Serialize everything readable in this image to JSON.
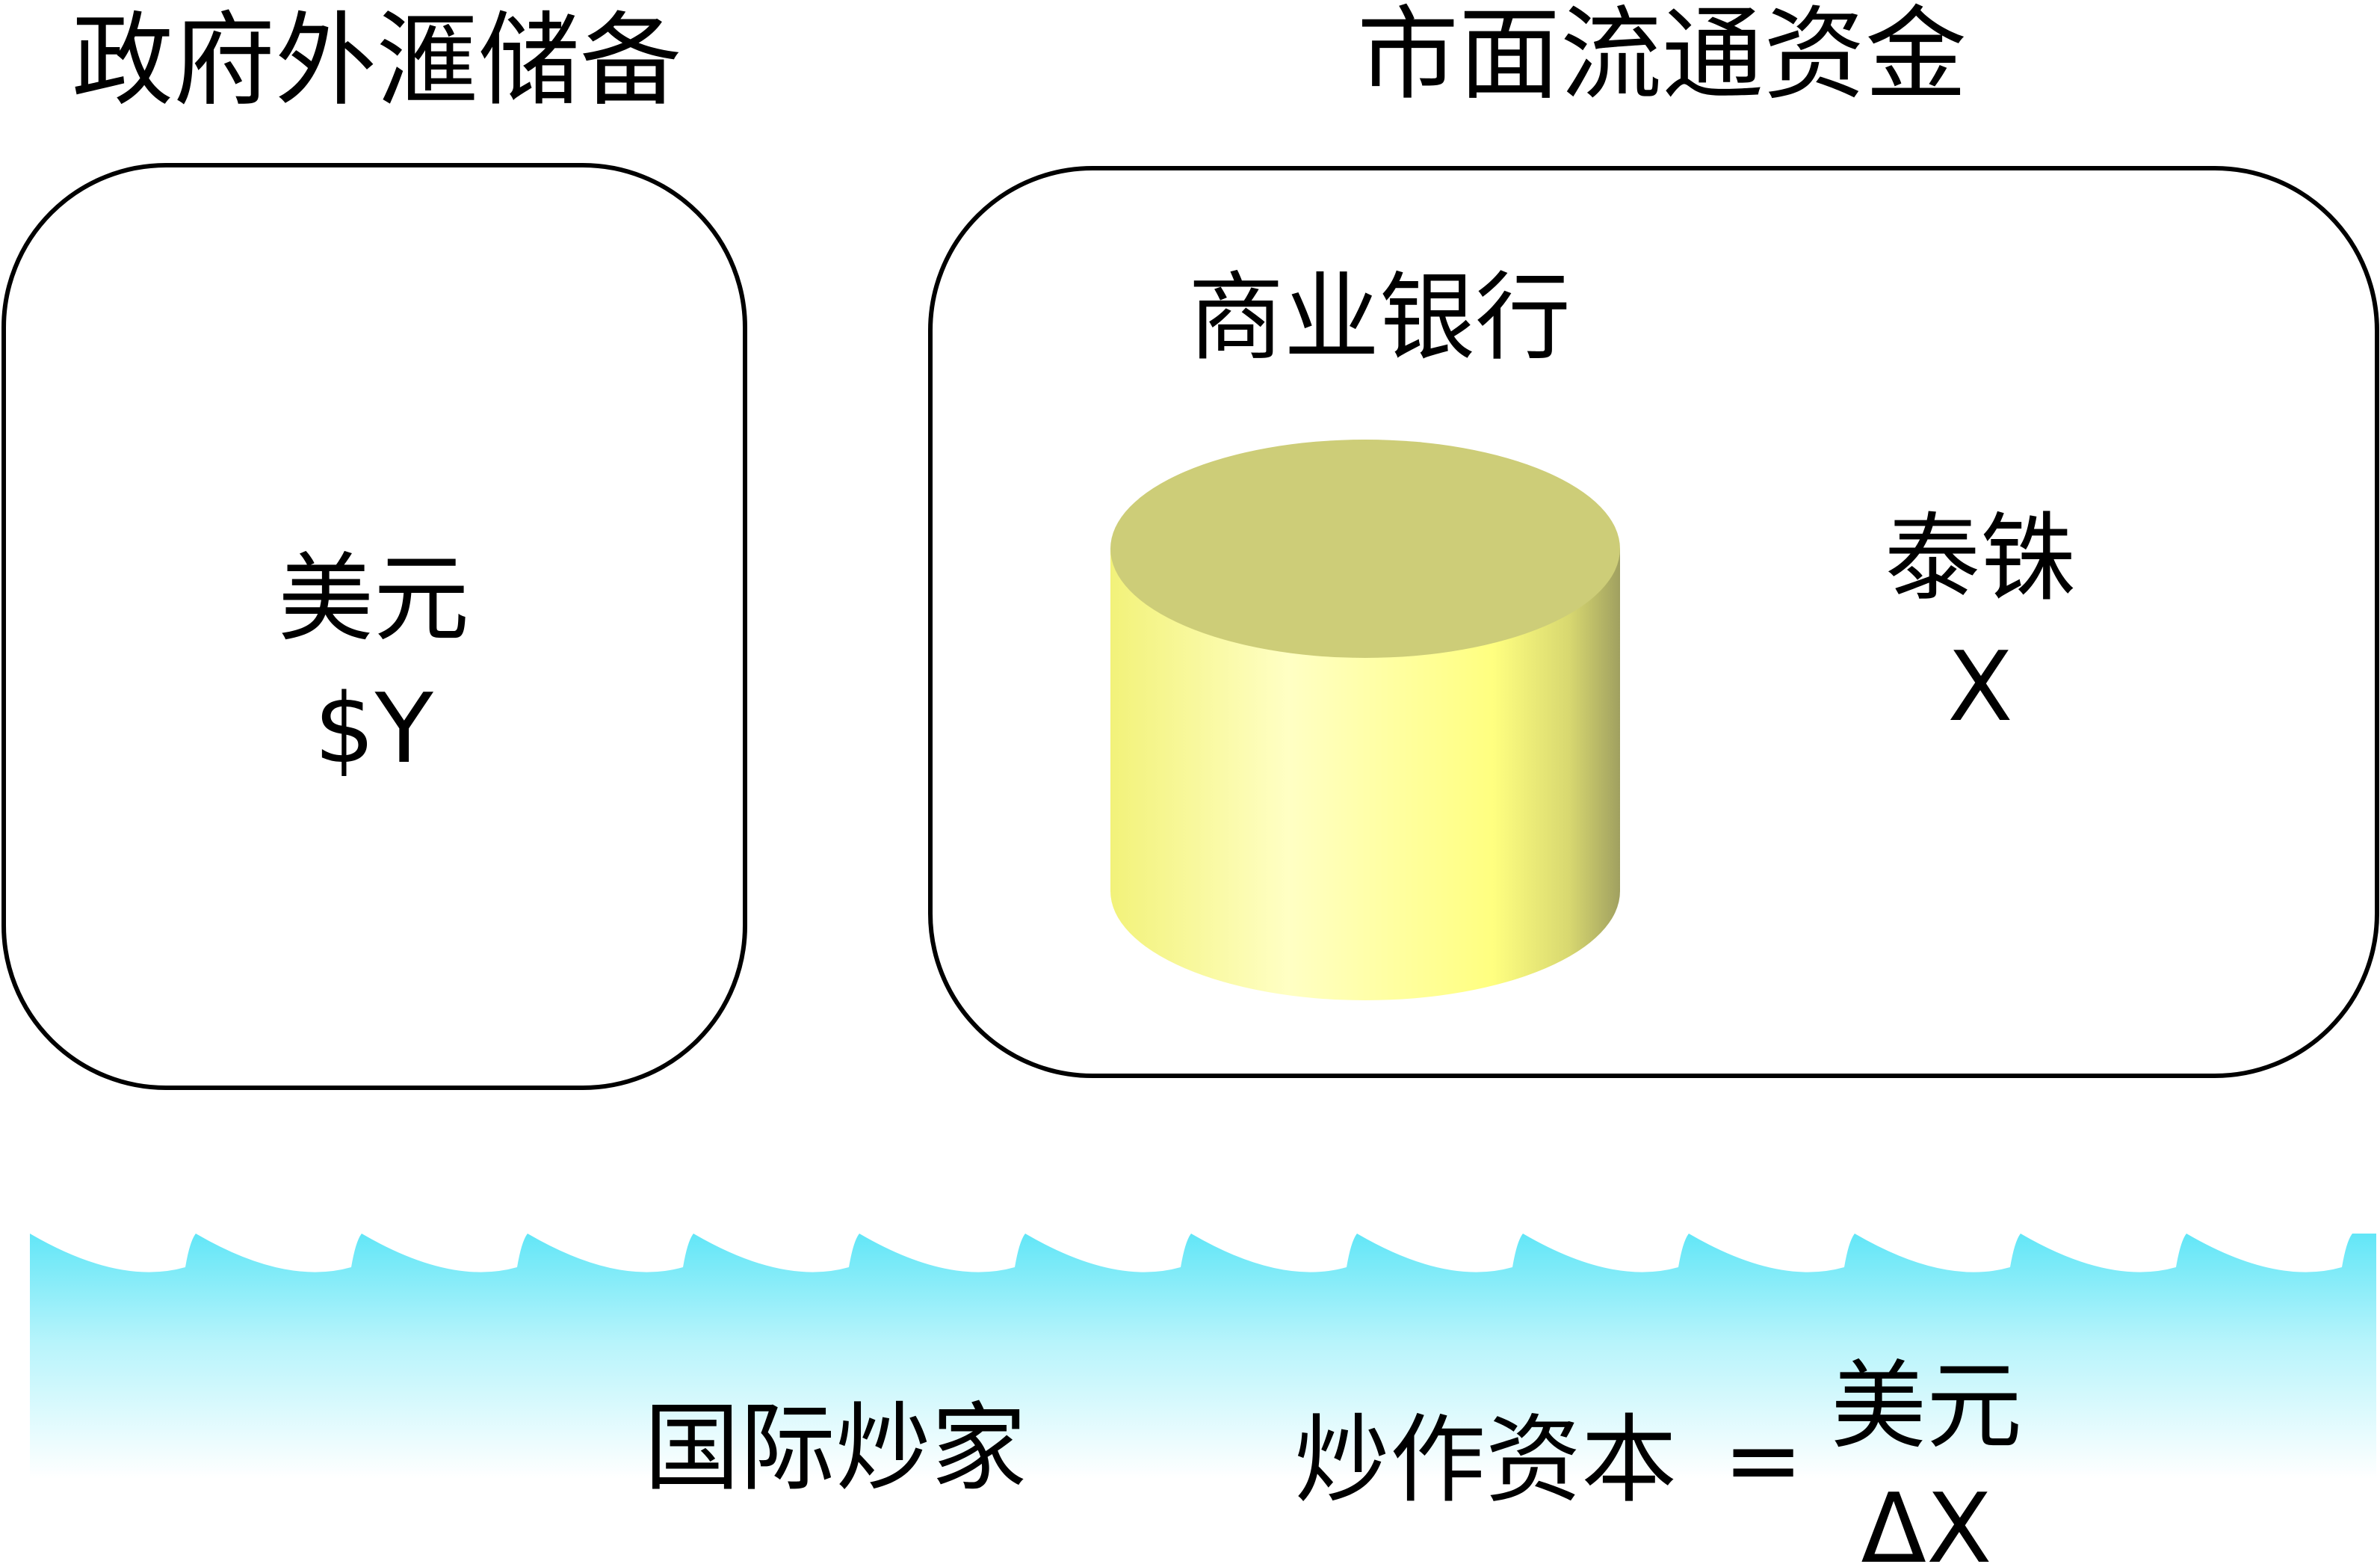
{
  "government_reserves": {
    "title": "政府外滙储备",
    "currency": "美元",
    "amount": "$Y"
  },
  "market_funds": {
    "title": "市面流通资金",
    "bank_label": "商业银行",
    "currency": "泰铢",
    "amount": "X"
  },
  "speculators": {
    "label": "国际炒家",
    "capital_label": "炒作资本",
    "equals": "=",
    "currency": "美元",
    "amount": "ΔX"
  },
  "colors": {
    "cylinder_top": "#cdcd78",
    "cylinder_side": "#ffff99",
    "water_top": "#66e8f8",
    "water_bottom": "#ffffff",
    "outline": "#000000"
  },
  "icons": {
    "bank": "cylinder-icon",
    "sea": "wave-band"
  }
}
